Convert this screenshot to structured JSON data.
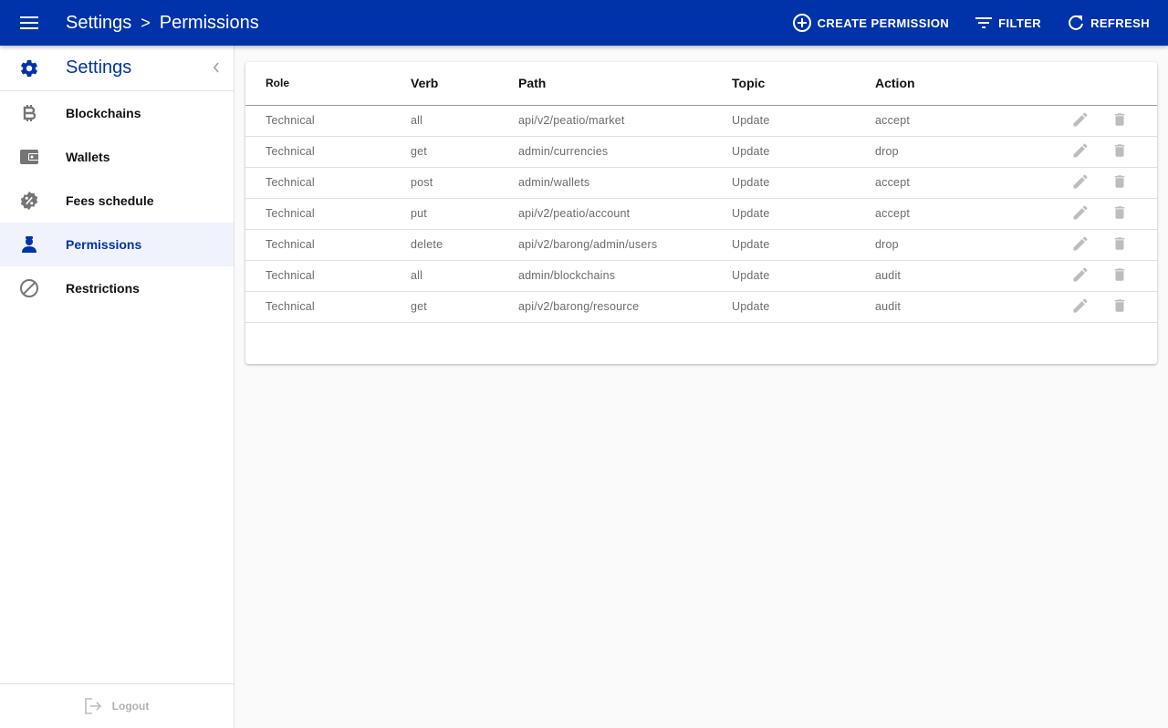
{
  "header": {
    "menu_icon": "menu-icon",
    "breadcrumb": [
      "Settings",
      "Permissions"
    ],
    "separator": ">",
    "actions": [
      {
        "label": "CREATE PERMISSION",
        "icon": "add-circle-icon"
      },
      {
        "label": "FILTER",
        "icon": "filter-icon"
      },
      {
        "label": "REFRESH",
        "icon": "refresh-icon"
      }
    ],
    "background": "#0033aa"
  },
  "sidebar": {
    "title": "Settings",
    "items": [
      {
        "label": "Blockchains",
        "icon": "bitcoin-icon"
      },
      {
        "label": "Wallets",
        "icon": "wallet-icon"
      },
      {
        "label": "Fees schedule",
        "icon": "percent-badge-icon"
      },
      {
        "label": "Permissions",
        "icon": "user-badge-icon",
        "active": true
      },
      {
        "label": "Restrictions",
        "icon": "block-icon"
      }
    ],
    "logout_label": "Logout"
  },
  "table": {
    "columns": [
      "Role",
      "Verb",
      "Path",
      "Topic",
      "Action"
    ],
    "rows": [
      {
        "role": "Technical",
        "verb": "all",
        "path": "api/v2/peatio/market",
        "topic": "Update",
        "action": "accept"
      },
      {
        "role": "Technical",
        "verb": "get",
        "path": "admin/currencies",
        "topic": "Update",
        "action": "drop"
      },
      {
        "role": "Technical",
        "verb": "post",
        "path": "admin/wallets",
        "topic": "Update",
        "action": "accept"
      },
      {
        "role": "Technical",
        "verb": "put",
        "path": "api/v2/peatio/account",
        "topic": "Update",
        "action": "accept"
      },
      {
        "role": "Technical",
        "verb": "delete",
        "path": "api/v2/barong/admin/users",
        "topic": "Update",
        "action": "drop"
      },
      {
        "role": "Technical",
        "verb": "all",
        "path": "admin/blockchains",
        "topic": "Update",
        "action": "audit"
      },
      {
        "role": "Technical",
        "verb": "get",
        "path": "api/v2/barong/resource",
        "topic": "Update",
        "action": "audit"
      }
    ]
  }
}
